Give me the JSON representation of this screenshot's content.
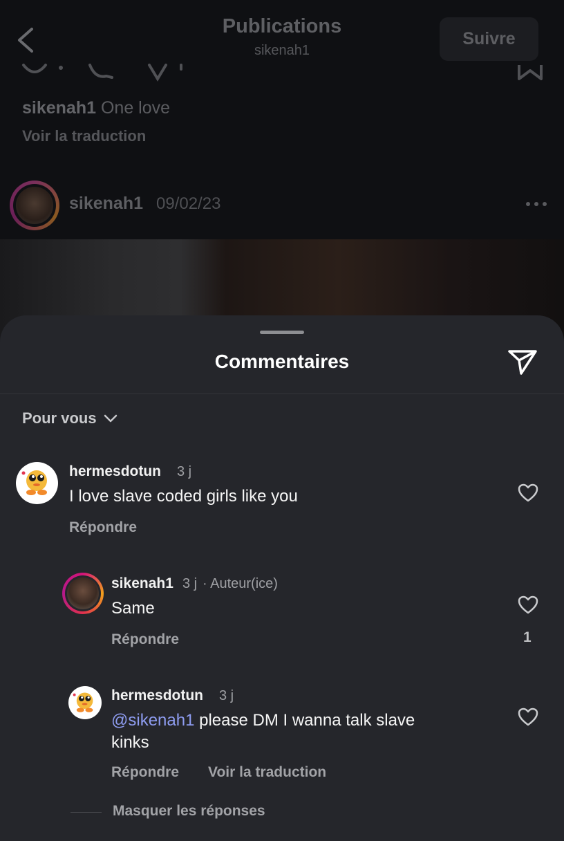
{
  "header": {
    "title": "Publications",
    "subtitle": "sikenah1",
    "follow_label": "Suivre"
  },
  "post": {
    "caption_user": "sikenah1",
    "caption_text": "One love",
    "translate_label": "Voir la traduction",
    "next_user": "sikenah1",
    "next_date": "09/02/23"
  },
  "sheet": {
    "title": "Commentaires",
    "filter_label": "Pour vous"
  },
  "comments": [
    {
      "user": "hermesdotun",
      "time": "3 j",
      "text": "I love slave coded girls like you",
      "reply_label": "Répondre"
    },
    {
      "user": "sikenah1",
      "time": "3 j",
      "author_badge": "· Auteur(ice)",
      "text": "Same",
      "reply_label": "Répondre",
      "likes": "1"
    },
    {
      "user": "hermesdotun",
      "time": "3 j",
      "mention": "@sikenah1",
      "text_line1": " please DM I wanna talk slave",
      "text_line2": "kinks",
      "reply_label": "Répondre",
      "translate_label": "Voir la traduction"
    }
  ],
  "hide_replies_label": "Masquer les réponses",
  "icons": {
    "back": "chevron-left-icon",
    "more": "more-horizontal-icon",
    "share": "send-icon",
    "filter": "chevron-down-icon",
    "like": "heart-icon",
    "bookmark": "bookmark-icon"
  }
}
